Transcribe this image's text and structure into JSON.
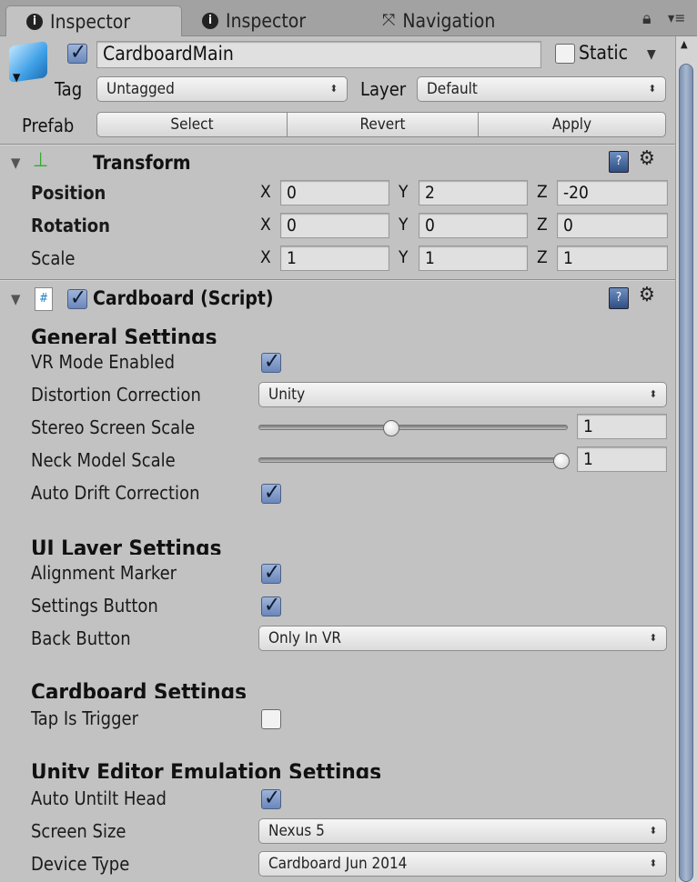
{
  "tabs": [
    {
      "label": "Inspector",
      "icon": "info-icon",
      "active": true
    },
    {
      "label": "Inspector",
      "icon": "info-icon",
      "active": false
    },
    {
      "label": "Navigation",
      "icon": "navigation-icon",
      "active": false
    }
  ],
  "object": {
    "name": "CardboardMain",
    "active": true,
    "static_label": "Static",
    "static": false,
    "tag_label": "Tag",
    "tag": "Untagged",
    "layer_label": "Layer",
    "layer": "Default",
    "prefab_label": "Prefab",
    "prefab_buttons": [
      "Select",
      "Revert",
      "Apply"
    ]
  },
  "transform": {
    "title": "Transform",
    "rows": [
      {
        "label": "Position",
        "x": "0",
        "y": "2",
        "z": "-20"
      },
      {
        "label": "Rotation",
        "x": "0",
        "y": "0",
        "z": "0"
      },
      {
        "label": "Scale",
        "x": "1",
        "y": "1",
        "z": "1"
      }
    ],
    "axes": [
      "X",
      "Y",
      "Z"
    ]
  },
  "script": {
    "title": "Cardboard (Script)",
    "enabled": true,
    "general": {
      "header": "General Settings",
      "vr_mode": {
        "label": "VR Mode Enabled",
        "checked": true
      },
      "distortion": {
        "label": "Distortion Correction",
        "value": "Unity"
      },
      "stereo": {
        "label": "Stereo Screen Scale",
        "value": "1",
        "slider_fraction": 0.43
      },
      "neck": {
        "label": "Neck Model Scale",
        "value": "1",
        "slider_fraction": 0.98
      },
      "drift": {
        "label": "Auto Drift Correction",
        "checked": true
      }
    },
    "ui_layer": {
      "header": "UI Layer Settings",
      "alignment": {
        "label": "Alignment Marker",
        "checked": true
      },
      "settings_btn": {
        "label": "Settings Button",
        "checked": true
      },
      "back_btn": {
        "label": "Back Button",
        "value": "Only In VR"
      }
    },
    "cardboard": {
      "header": "Cardboard Settings",
      "tap": {
        "label": "Tap Is Trigger",
        "checked": false
      }
    },
    "emulation": {
      "header": "Unity Editor Emulation Settings",
      "untilt": {
        "label": "Auto Untilt Head",
        "checked": true
      },
      "screen": {
        "label": "Screen Size",
        "value": "Nexus 5"
      },
      "device": {
        "label": "Device Type",
        "value": "Cardboard Jun 2014"
      }
    }
  }
}
